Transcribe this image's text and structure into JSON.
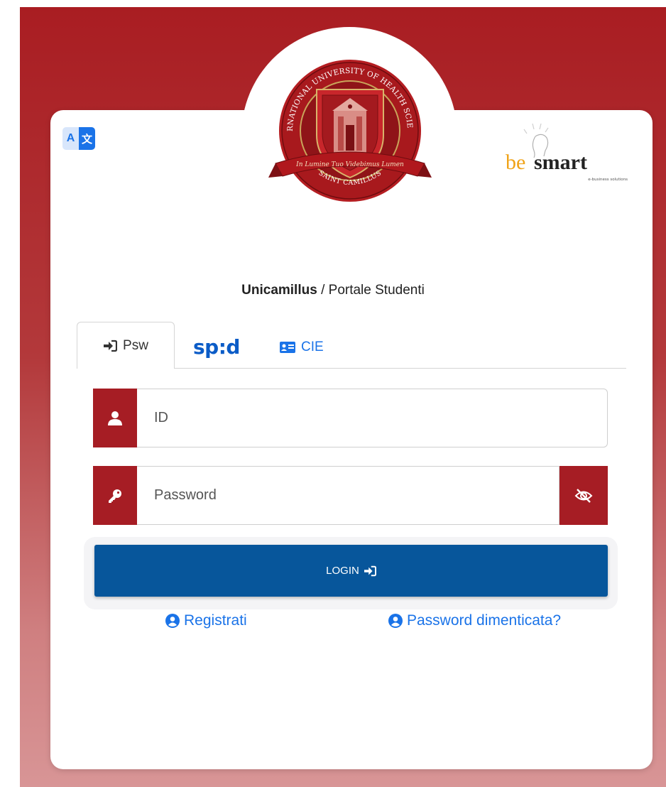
{
  "header": {
    "translate_left": "A",
    "translate_right": "文",
    "logo": {
      "arc_top": "INTERNATIONAL UNIVERSITY OF HEALTH SCIENCES",
      "arc_bottom": "SAINT CAMILLUS",
      "motto": "In Lumine Tuo Videbimus Lumen"
    },
    "partner": {
      "be": "be",
      "smart": "smart",
      "tagline": "e-business solutions"
    }
  },
  "title": {
    "org": "Unicamillus",
    "separator": " / ",
    "portal": "Portale Studenti"
  },
  "tabs": [
    {
      "label": "Psw",
      "icon": "sign-in-icon",
      "active": true
    },
    {
      "label": "sp:d",
      "icon": "spid-logo"
    },
    {
      "label": "CIE",
      "icon": "id-card-icon"
    }
  ],
  "form": {
    "id_placeholder": "ID",
    "password_placeholder": "Password",
    "login_label": "LOGIN"
  },
  "links": {
    "register": "Registrati",
    "forgot": "Password dimenticata?"
  },
  "colors": {
    "brand_red": "#a61d24",
    "login_blue": "#07569b",
    "link_blue": "#1a73e8"
  }
}
